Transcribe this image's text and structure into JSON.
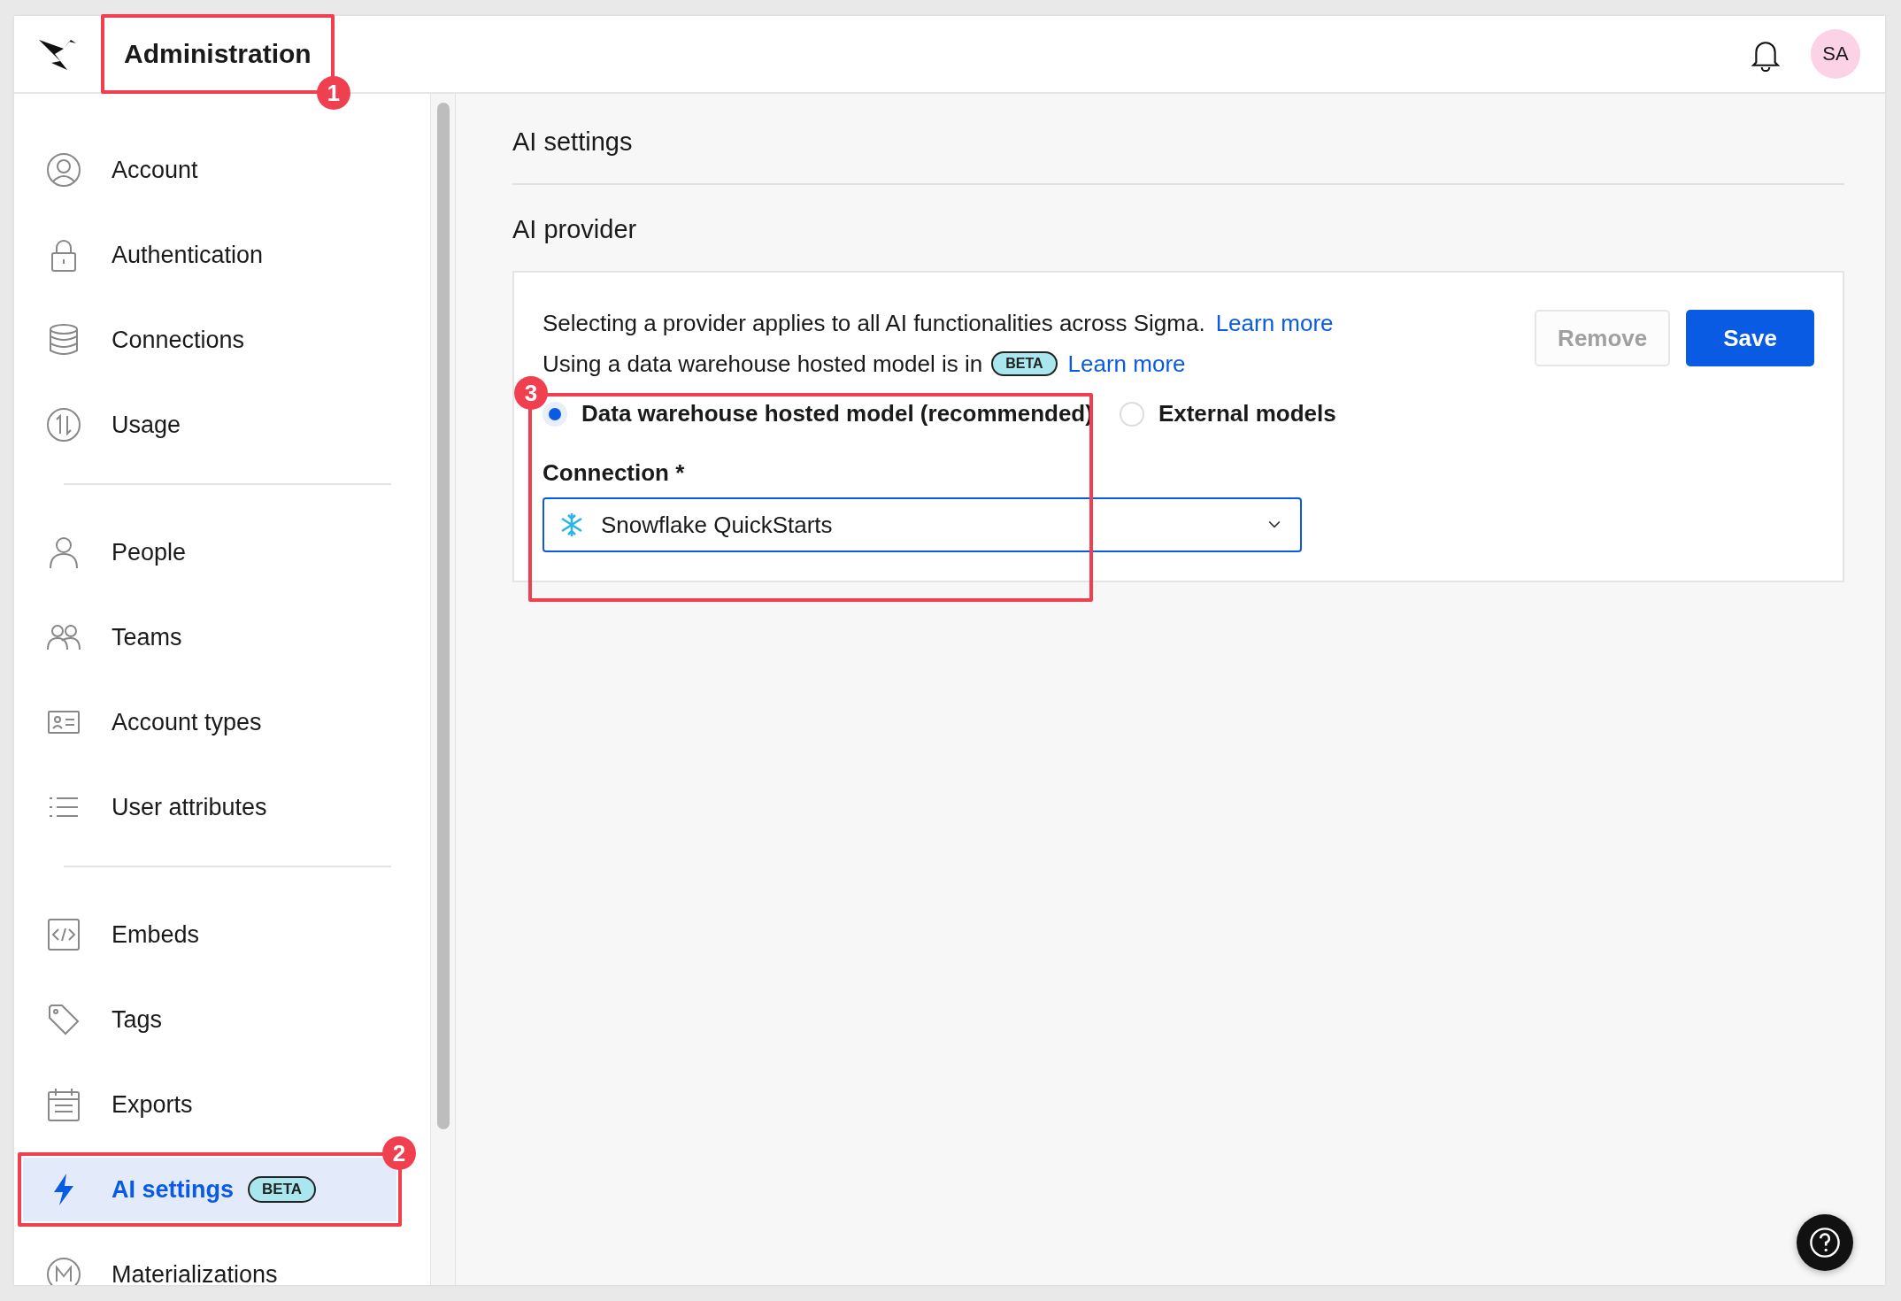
{
  "header": {
    "title": "Administration",
    "avatar": "SA",
    "annotation": "1"
  },
  "sidebar": {
    "groups": [
      {
        "items": [
          {
            "label": "Account",
            "kind": "account",
            "selected": false
          },
          {
            "label": "Authentication",
            "kind": "lock",
            "selected": false
          },
          {
            "label": "Connections",
            "kind": "database",
            "selected": false
          },
          {
            "label": "Usage",
            "kind": "usage",
            "selected": false
          }
        ]
      },
      {
        "items": [
          {
            "label": "People",
            "kind": "person",
            "selected": false
          },
          {
            "label": "Teams",
            "kind": "team",
            "selected": false
          },
          {
            "label": "Account types",
            "kind": "idcard",
            "selected": false
          },
          {
            "label": "User attributes",
            "kind": "list",
            "selected": false
          }
        ]
      },
      {
        "items": [
          {
            "label": "Embeds",
            "kind": "code",
            "selected": false
          },
          {
            "label": "Tags",
            "kind": "tag",
            "selected": false
          },
          {
            "label": "Exports",
            "kind": "calendar",
            "selected": false
          },
          {
            "label": "AI settings",
            "kind": "bolt",
            "selected": true,
            "badge": "BETA",
            "annotation": "2"
          },
          {
            "label": "Materializations",
            "kind": "m",
            "selected": false
          }
        ]
      }
    ]
  },
  "main": {
    "title": "AI settings",
    "section": "AI provider",
    "card": {
      "line1": "Selecting a provider applies to all AI functionalities across Sigma.",
      "link1": "Learn more",
      "line2": "Using a data warehouse hosted model is in",
      "badge": "BETA",
      "link2": "Learn more",
      "buttons": [
        {
          "label": "Remove",
          "kind": "secondary",
          "disabled": true
        },
        {
          "label": "Save",
          "kind": "primary",
          "disabled": false
        }
      ],
      "options": [
        {
          "label": "Data warehouse hosted model (recommended)",
          "selected": true
        },
        {
          "label": "External models",
          "selected": false
        }
      ],
      "connection_label": "Connection *",
      "connection_value": "Snowflake QuickStarts",
      "annotation": "3"
    }
  }
}
